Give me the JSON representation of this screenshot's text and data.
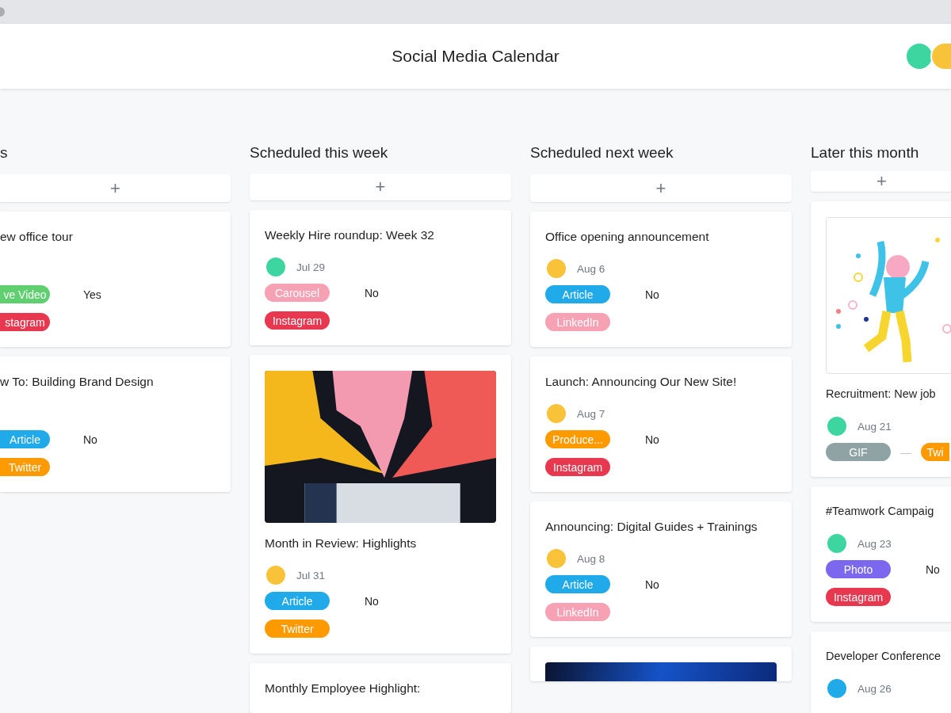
{
  "window": {
    "title": "Social Media Calendar"
  },
  "header_avatars": [
    {
      "color": "#3dd6a0"
    },
    {
      "color": "#f8c239"
    }
  ],
  "columns": [
    {
      "title": "s",
      "add_label": "+",
      "cards": [
        {
          "title": "ew office tour",
          "type_tag": {
            "label": "ve Video",
            "color": "#5fcf6f"
          },
          "answer": "Yes",
          "channel_tag": {
            "label": "stagram",
            "color": "#e8384f"
          }
        },
        {
          "title": "w To: Building Brand Design",
          "type_tag": {
            "label": "Article",
            "color": "#20aaea"
          },
          "answer": "No",
          "channel_tag": {
            "label": "Twitter",
            "color": "#fd9a00"
          }
        }
      ]
    },
    {
      "title": "Scheduled this week",
      "add_label": "+",
      "cards": [
        {
          "title": "Weekly Hire roundup: Week 32",
          "avatar": {
            "color": "#3dd6a0"
          },
          "date": "Jul 29",
          "type_tag": {
            "label": "Carousel",
            "color": "#f7a1b5"
          },
          "answer": "No",
          "channel_tag": {
            "label": "Instagram",
            "color": "#e8384f"
          }
        },
        {
          "image": {
            "kind": "bubbles"
          },
          "title": "Month in Review: Highlights",
          "avatar": {
            "color": "#f8c239"
          },
          "date": "Jul 31",
          "type_tag": {
            "label": "Article",
            "color": "#20aaea"
          },
          "answer": "No",
          "channel_tag": {
            "label": "Twitter",
            "color": "#fd9a00"
          }
        },
        {
          "title": "Monthly Employee Highlight:"
        }
      ]
    },
    {
      "title": "Scheduled next week",
      "add_label": "+",
      "cards": [
        {
          "title": "Office opening announcement",
          "avatar": {
            "color": "#f8c239"
          },
          "date": "Aug 6",
          "type_tag": {
            "label": "Article",
            "color": "#20aaea"
          },
          "answer": "No",
          "channel_tag": {
            "label": "LinkedIn",
            "color": "#f7a1b5"
          }
        },
        {
          "title": "Launch: Announcing Our New Site!",
          "avatar": {
            "color": "#f8c239"
          },
          "date": "Aug 7",
          "type_tag": {
            "label": "Produce...",
            "color": "#fd9a00"
          },
          "answer": "No",
          "channel_tag": {
            "label": "Instagram",
            "color": "#e8384f"
          }
        },
        {
          "title": "Announcing: Digital Guides + Trainings",
          "avatar": {
            "color": "#f8c239"
          },
          "date": "Aug 8",
          "type_tag": {
            "label": "Article",
            "color": "#20aaea"
          },
          "answer": "No",
          "channel_tag": {
            "label": "LinkedIn",
            "color": "#f7a1b5"
          }
        },
        {
          "image": {
            "kind": "photo"
          }
        }
      ]
    },
    {
      "title": "Later this month",
      "add_label": "+",
      "cards": [
        {
          "image": {
            "kind": "dancer"
          },
          "title": "Recruitment: New job",
          "avatar": {
            "color": "#3dd6a0"
          },
          "date": "Aug 21",
          "type_tag": {
            "label": "GIF",
            "color": "#8fa3a5"
          },
          "answer": "—",
          "channel_tag": {
            "label": "Twi",
            "color": "#fd9a00"
          },
          "inline_channel": true
        },
        {
          "title": "#Teamwork Campaig",
          "avatar": {
            "color": "#3dd6a0"
          },
          "date": "Aug 23",
          "type_tag": {
            "label": "Photo",
            "color": "#7b68ee"
          },
          "answer": "No",
          "channel_tag": {
            "label": "Instagram",
            "color": "#e8384f"
          }
        },
        {
          "title": "Developer Conference",
          "avatar": {
            "color": "#20aaea"
          },
          "date": "Aug 26"
        }
      ]
    }
  ]
}
